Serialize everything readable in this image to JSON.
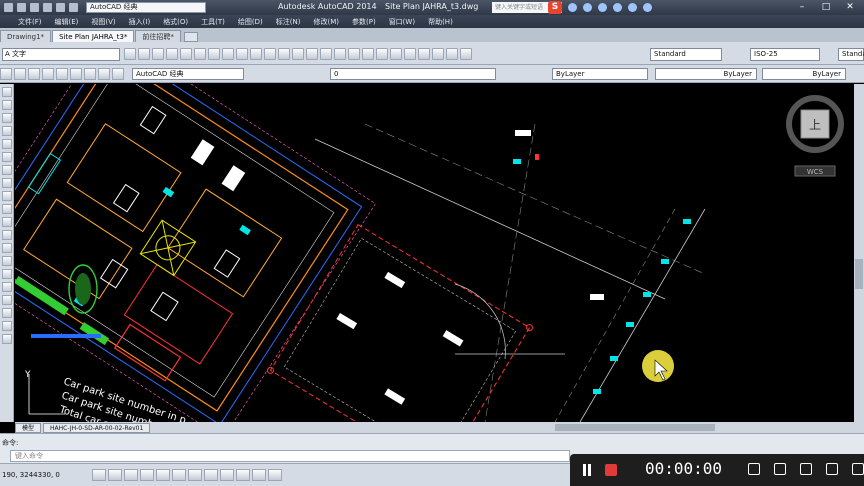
{
  "window": {
    "workspace": "AutoCAD 经典",
    "app_title": "Autodesk AutoCAD 2014",
    "file_title": "Site Plan JAHRA_t3.dwg",
    "search_placeholder": "键入关键字或短语",
    "brand_letter": "S"
  },
  "menu": [
    "文件(F)",
    "编辑(E)",
    "视图(V)",
    "插入(I)",
    "格式(O)",
    "工具(T)",
    "绘图(D)",
    "标注(N)",
    "修改(M)",
    "参数(P)",
    "窗口(W)",
    "帮助(H)"
  ],
  "tabs": [
    {
      "label": "Drawing1*",
      "active": false
    },
    {
      "label": "Site Plan JAHRA_t3*",
      "active": true
    },
    {
      "label": "前往招聘*",
      "active": false
    }
  ],
  "toolbar": {
    "font_value": "A 文字",
    "text_style": "Standard",
    "dim_style": "ISO-25",
    "table_style": "Standa"
  },
  "properties": {
    "workspace": "AutoCAD 经典",
    "layer": "0",
    "color": "ByLayer",
    "linetype": "ByLayer",
    "lineweight": "ByLayer"
  },
  "viewcube": {
    "label": "上",
    "wcs": "WCS"
  },
  "drawing": {
    "annotations": [
      "Car park site number in p",
      "Car park site number",
      "Total car park"
    ],
    "ucs_label": "Y",
    "accent": "#ff3333"
  },
  "layout_tab": "模型",
  "sheet_label": "HAHC-JH-0-SD-AR-00-02-Rev01",
  "cmdline": {
    "label": "命令:",
    "prompt": "键入命令"
  },
  "status": {
    "coords": "190, 3244330, 0"
  },
  "recorder": {
    "time": "00:00:00"
  },
  "colors": {
    "canvas": "#000000",
    "title_bar": "#2f3846",
    "record": "#e03a3a"
  }
}
